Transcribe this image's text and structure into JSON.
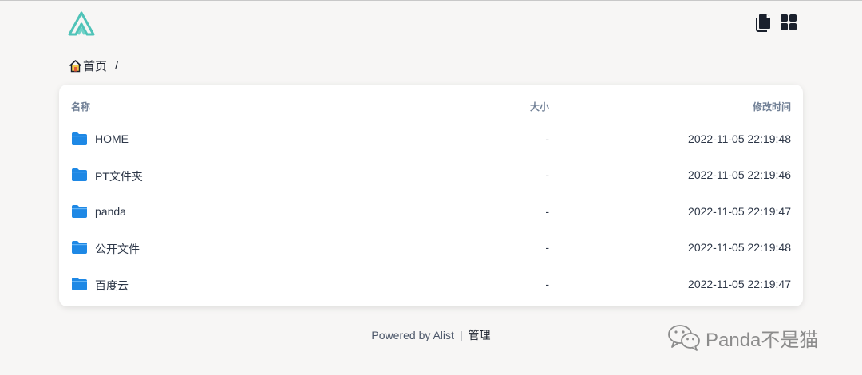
{
  "header": {
    "logo_icon": "alist-logo",
    "actions": [
      {
        "icon": "copy-icon"
      },
      {
        "icon": "grid-view-icon"
      }
    ]
  },
  "breadcrumb": {
    "home_label": "首页",
    "separator": "/"
  },
  "table": {
    "columns": {
      "name": "名称",
      "size": "大小",
      "modified": "修改时间"
    },
    "rows": [
      {
        "name": "HOME",
        "size": "-",
        "modified": "2022-11-05 22:19:48"
      },
      {
        "name": "PT文件夹",
        "size": "-",
        "modified": "2022-11-05 22:19:46"
      },
      {
        "name": "panda",
        "size": "-",
        "modified": "2022-11-05 22:19:47"
      },
      {
        "name": "公开文件",
        "size": "-",
        "modified": "2022-11-05 22:19:48"
      },
      {
        "name": "百度云",
        "size": "-",
        "modified": "2022-11-05 22:19:47"
      }
    ]
  },
  "footer": {
    "powered_by": "Powered by Alist",
    "separator": "|",
    "admin_link": "管理"
  },
  "watermark": {
    "text": "Panda不是猫"
  },
  "colors": {
    "folder": "#1e88e5",
    "logo_teal": "#4fc3b8",
    "background": "#f7f6f5"
  }
}
